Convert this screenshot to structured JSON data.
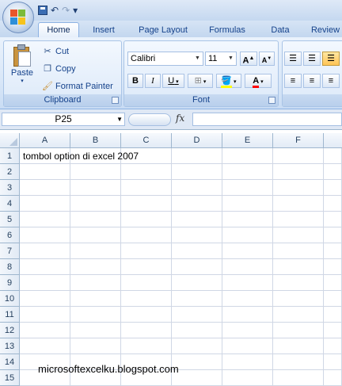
{
  "quick_access": {
    "save": "save-icon",
    "undo": "↶",
    "redo": "↷",
    "customize": "▾"
  },
  "tabs": [
    "Home",
    "Insert",
    "Page Layout",
    "Formulas",
    "Data",
    "Review"
  ],
  "clipboard": {
    "group_label": "Clipboard",
    "paste": "Paste",
    "cut": "Cut",
    "copy": "Copy",
    "format_painter": "Format Painter"
  },
  "font": {
    "group_label": "Font",
    "family": "Calibri",
    "size": "11",
    "grow": "A",
    "shrink": "A",
    "bold": "B",
    "italic": "I",
    "underline": "U",
    "font_color_letter": "A"
  },
  "formula_bar": {
    "name_box": "P25",
    "fx": "fx",
    "formula": ""
  },
  "sheet": {
    "columns": [
      "A",
      "B",
      "C",
      "D",
      "E",
      "F"
    ],
    "rows": [
      "1",
      "2",
      "3",
      "4",
      "5",
      "6",
      "7",
      "8",
      "9",
      "10",
      "11",
      "12",
      "13",
      "14",
      "15"
    ],
    "a1_text": "tombol option di excel 2007"
  },
  "watermark": "microsoftexcelku.blogspot.com",
  "colors": {
    "fill_highlight": "#ffff00",
    "font_color": "#ff0000"
  }
}
